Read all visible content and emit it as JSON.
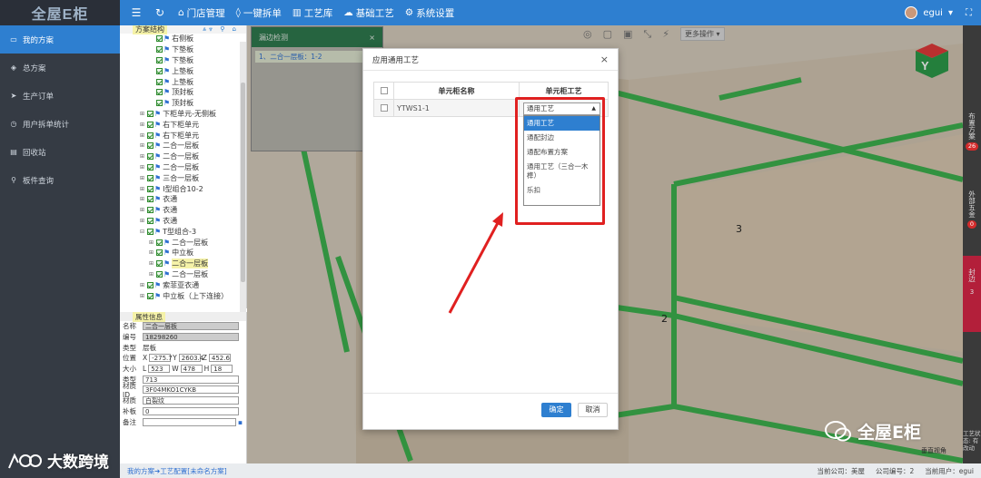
{
  "app": {
    "logo": "全屋E柜"
  },
  "topbar": {
    "menu": [
      {
        "icon": "home-icon",
        "glyph": "⌂",
        "label": "门店管理"
      },
      {
        "icon": "shield-icon",
        "glyph": "◊",
        "label": "一键拆单"
      },
      {
        "icon": "bars-icon",
        "glyph": "▥",
        "label": "工艺库"
      },
      {
        "icon": "cloud-icon",
        "glyph": "☁",
        "label": "基础工艺"
      },
      {
        "icon": "gear-icon",
        "glyph": "⚙",
        "label": "系统设置"
      }
    ],
    "user": "egui",
    "user_caret": "▾",
    "expand": "⛶"
  },
  "sidebar": {
    "items": [
      {
        "icon": "monitor-icon",
        "glyph": "▭",
        "label": "我的方案",
        "active": true
      },
      {
        "icon": "diamond-icon",
        "glyph": "◈",
        "label": "总方案"
      },
      {
        "icon": "send-icon",
        "glyph": "➤",
        "label": "生产订单"
      },
      {
        "icon": "clock-icon",
        "glyph": "◷",
        "label": "用户拆单统计"
      },
      {
        "icon": "trash-icon",
        "glyph": "▤",
        "label": "回收站"
      },
      {
        "icon": "search-icon",
        "glyph": "⚲",
        "label": "板件查询"
      }
    ]
  },
  "tree": {
    "title": "方案结构",
    "tools": "⩓⩔ ⚲ ⌂",
    "nodes": [
      {
        "indent": 2,
        "pm": "",
        "label": "右侧板"
      },
      {
        "indent": 2,
        "pm": "",
        "label": "下垫板"
      },
      {
        "indent": 2,
        "pm": "",
        "label": "下垫板"
      },
      {
        "indent": 2,
        "pm": "",
        "label": "上垫板"
      },
      {
        "indent": 2,
        "pm": "",
        "label": "上垫板"
      },
      {
        "indent": 2,
        "pm": "",
        "label": "顶封板"
      },
      {
        "indent": 2,
        "pm": "",
        "label": "顶封板"
      },
      {
        "indent": 1,
        "pm": "⊞",
        "label": "下柜单元-无侧板"
      },
      {
        "indent": 1,
        "pm": "⊞",
        "label": "右下柜单元"
      },
      {
        "indent": 1,
        "pm": "⊞",
        "label": "右下柜单元"
      },
      {
        "indent": 1,
        "pm": "⊞",
        "label": "二合一层板"
      },
      {
        "indent": 1,
        "pm": "⊞",
        "label": "二合一层板"
      },
      {
        "indent": 1,
        "pm": "⊞",
        "label": "二合一层板"
      },
      {
        "indent": 1,
        "pm": "⊞",
        "label": "三合一层板"
      },
      {
        "indent": 1,
        "pm": "⊞",
        "label": "I型组合10-2"
      },
      {
        "indent": 1,
        "pm": "⊞",
        "label": "衣通"
      },
      {
        "indent": 1,
        "pm": "⊞",
        "label": "衣通"
      },
      {
        "indent": 1,
        "pm": "⊞",
        "label": "衣通"
      },
      {
        "indent": 1,
        "pm": "⊟",
        "label": "T型组合-3"
      },
      {
        "indent": 2,
        "pm": "⊞",
        "label": "二合一层板"
      },
      {
        "indent": 2,
        "pm": "⊞",
        "label": "中立板"
      },
      {
        "indent": 2,
        "pm": "⊞",
        "label": "二合一层板",
        "selected": true
      },
      {
        "indent": 2,
        "pm": "⊞",
        "label": "二合一层板"
      },
      {
        "indent": 1,
        "pm": "⊞",
        "label": "索菲亚衣通"
      },
      {
        "indent": 1,
        "pm": "⊞",
        "label": "中立板（上下连接）"
      }
    ]
  },
  "props": {
    "title": "属性信息",
    "name_label": "名称",
    "name_value": "二合一层板",
    "code_label": "编号",
    "code_value": "18298260",
    "type_label": "类型",
    "type_value": "层板",
    "pos_label": "位置",
    "pos_x_label": "X",
    "pos_x": "-275.7",
    "pos_y_label": "Y",
    "pos_y": "2603.4",
    "pos_z_label": "Z",
    "pos_z": "452.6",
    "size_label": "大小",
    "size_l_label": "L",
    "size_l": "523",
    "size_w_label": "W",
    "size_w": "478",
    "size_h_label": "H",
    "size_h": "18",
    "type2_label": "类型",
    "type2_value": "713",
    "matcode_label": "材质ID",
    "matcode_value": "3F04MKO1CYKB",
    "mat_label": "材质",
    "mat_value": "白裂纹",
    "board_label": "补板",
    "board_value": "0",
    "note_label": "备注",
    "save_glyph": "▪"
  },
  "canvas": {
    "tools": [
      "◎",
      "▢",
      "▣",
      "⤡",
      "⚡"
    ],
    "more_label": "更多操作 ▾",
    "label_3": "3",
    "label_2": "2",
    "view_label": "垂直视角"
  },
  "leak_panel": {
    "title": "漏边检测",
    "close": "×",
    "row": "1、二合一层板：1-2"
  },
  "right_rail": {
    "tabs": [
      {
        "label": "布置方案",
        "count": "26"
      },
      {
        "label": "外部五金",
        "count": "0"
      },
      {
        "label": "封边",
        "count": "3",
        "active": true
      }
    ],
    "bottom_text": "工艺状态: 有改动"
  },
  "dialog": {
    "title": "应用通用工艺",
    "close": "×",
    "col_name": "单元柜名称",
    "col_craft": "单元柜工艺",
    "row_name": "YTWS1-1",
    "select_value": "通用工艺",
    "select_arrow": "▲",
    "options": [
      "通用工艺",
      "通配封边",
      "通配布置方案",
      "通用工艺（三合一木榫）",
      "乐扣"
    ],
    "ok_label": "确定",
    "cancel_label": "取消"
  },
  "bottombar": {
    "path": "我的方案➔工艺配置[未命名方案]",
    "node": "当前公司：美屋",
    "company": "公司编号：2",
    "user": "当前用户：egui"
  },
  "watermark": {
    "text": "全屋E柜",
    "text2": "大数跨境"
  },
  "colors": {
    "topbar": "#2e7fd0",
    "sidebar": "#353b44",
    "accent": "#2e7fd0",
    "annotation": "#e02020",
    "board": "#36b24a"
  }
}
